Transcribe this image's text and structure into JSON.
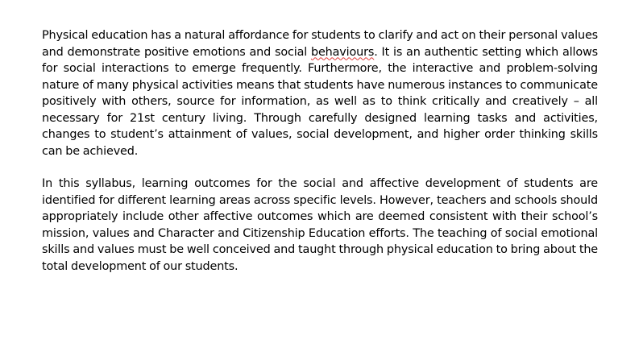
{
  "document": {
    "paragraph_1": {
      "before": "Physical education has a natural affordance for students to clarify and act on their personal values and demonstrate positive emotions and social ",
      "flagged_word": "behaviours",
      "after": ". It is an authentic setting which allows for social interactions to emerge frequently. Furthermore, the interactive and problem-solving nature of many physical activities means that students have numerous instances to communicate positively with others, source for information, as well as to think critically and creatively – all necessary for 21st century living. Through carefully designed learning tasks and activities, changes to student’s attainment of values, social development, and higher order thinking skills can be achieved."
    },
    "paragraph_2": "In this syllabus, learning outcomes for the social and affective development of students are identified for different learning areas across specific levels. However, teachers and schools should appropriately include other affective outcomes which are deemed consistent with their school’s mission, values and Character and Citizenship Education efforts. The teaching of social emotional skills and values must be well conceived and taught through physical education to bring about the total development of our students.",
    "colors": {
      "text": "#000000",
      "background": "#ffffff",
      "spellcheck_underline": "#e23b3b"
    }
  }
}
